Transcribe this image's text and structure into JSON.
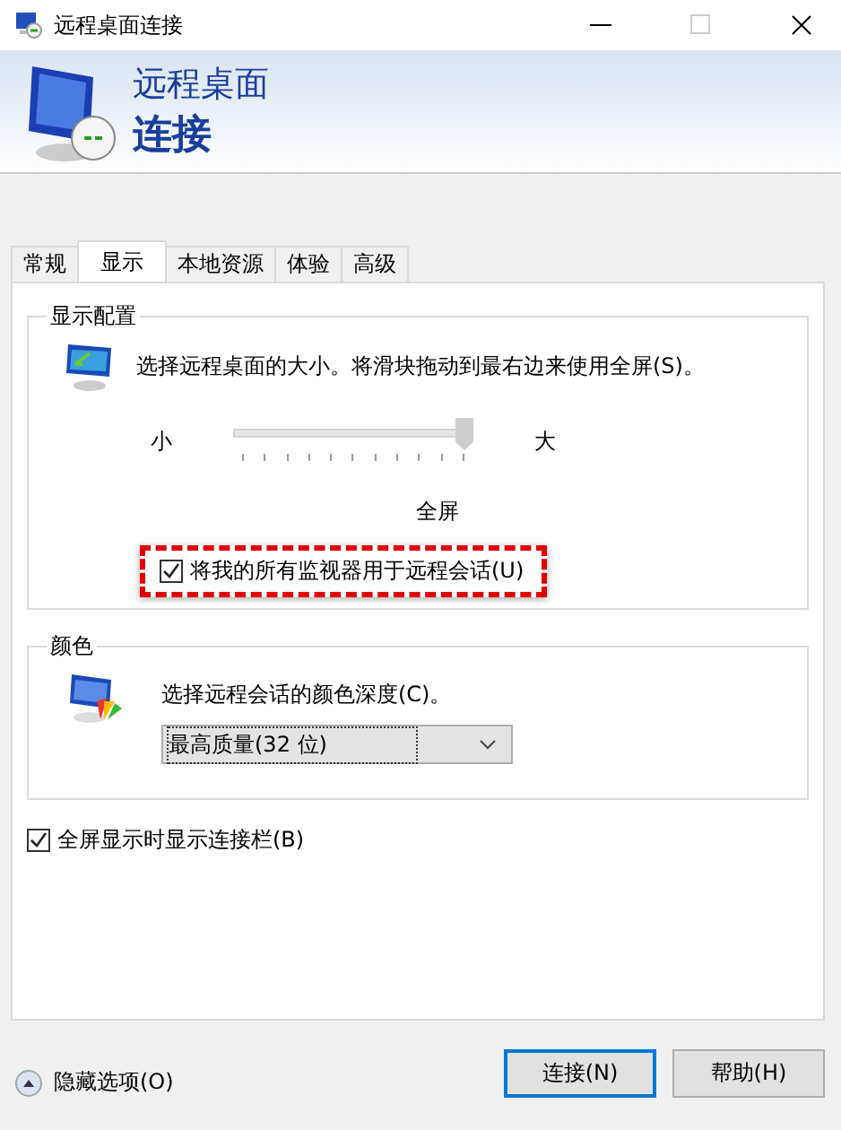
{
  "window": {
    "title": "远程桌面连接"
  },
  "header": {
    "line_1": "远程桌面",
    "line_2": "连接"
  },
  "tabs": [
    {
      "label": "常规",
      "selected": false
    },
    {
      "label": "显示",
      "selected": true
    },
    {
      "label": "本地资源",
      "selected": false
    },
    {
      "label": "体验",
      "selected": false
    },
    {
      "label": "高级",
      "selected": false
    }
  ],
  "display_group": {
    "title": "显示配置",
    "description": "选择远程桌面的大小。将滑块拖动到最右边来使用全屏(S)。",
    "slider": {
      "min_label": "小",
      "max_label": "大",
      "level": 1,
      "reading": "全屏"
    },
    "checkbox": {
      "label": "将我的所有监视器用于远程会话(U)",
      "checked": true,
      "highlighted": true
    }
  },
  "color_group": {
    "title": "颜色",
    "description": "选择远程会话的颜色深度(C)。",
    "dropdown": {
      "value": "最高质量(32 位)"
    }
  },
  "connection_bar_checkbox": {
    "label": "全屏显示时显示连接栏(B)",
    "checked": true
  },
  "options_toggle": {
    "label": "隐藏选项(O)"
  },
  "buttons": [
    {
      "label": "连接(N)",
      "selected": true
    },
    {
      "label": "帮助(H)",
      "selected": false
    }
  ]
}
